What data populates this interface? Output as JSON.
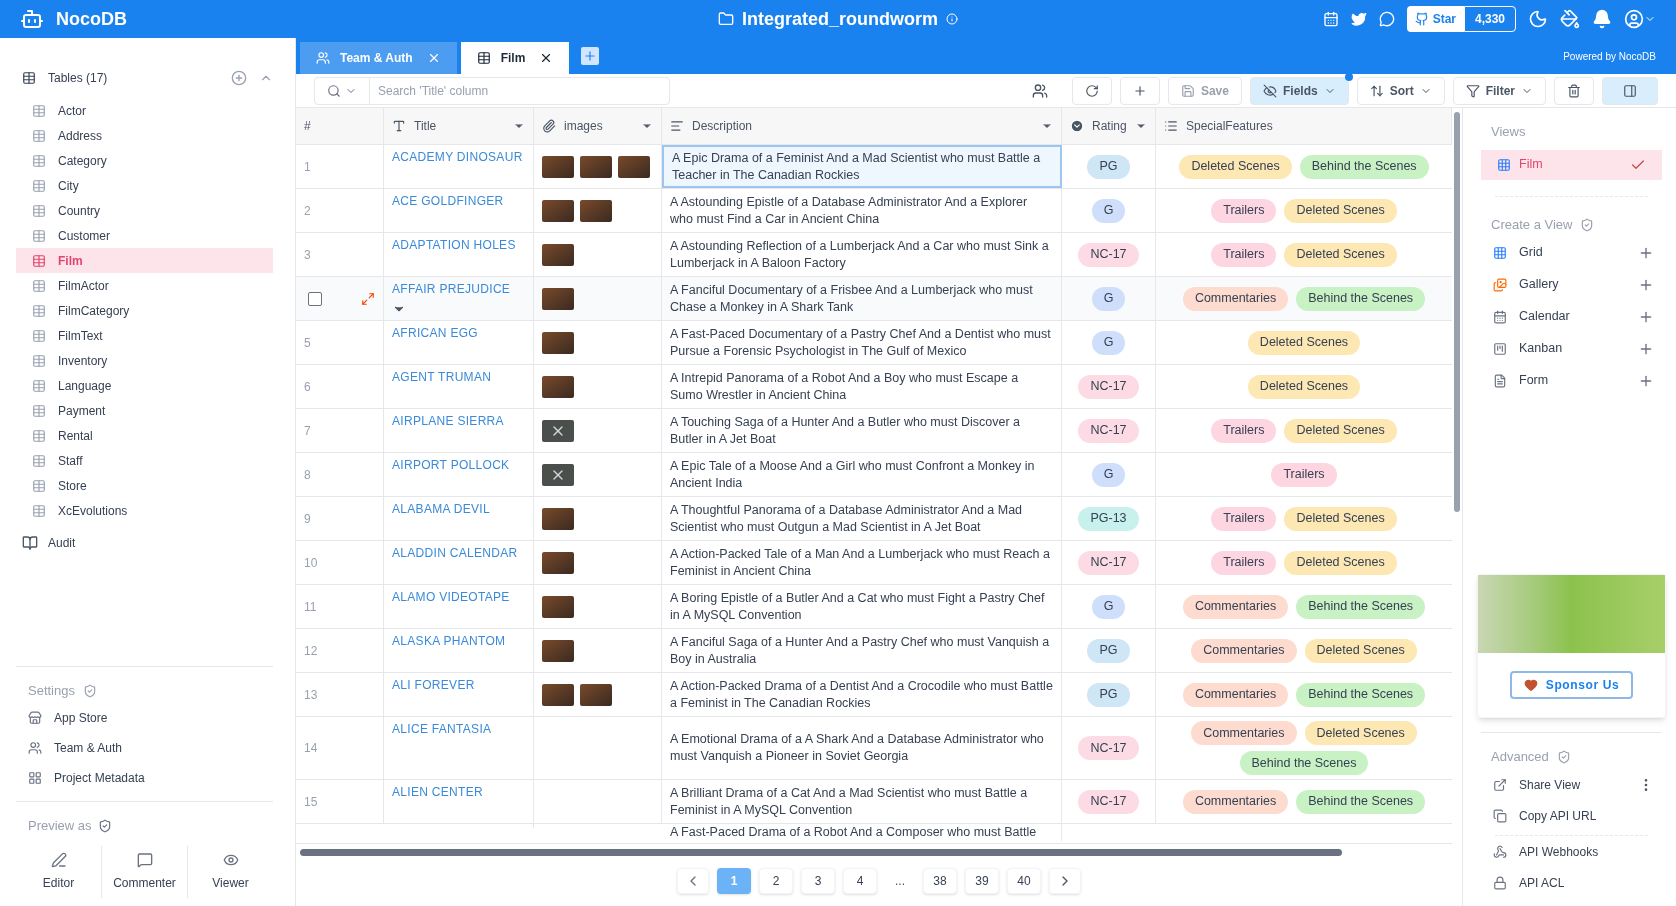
{
  "top_bar": {
    "brand": "NocoDB",
    "project": "Integrated_roundworm",
    "star_label": "Star",
    "star_count": "4,330"
  },
  "tabs": [
    {
      "label": "Team & Auth",
      "kind": "team",
      "selected": false
    },
    {
      "label": "Film",
      "kind": "table",
      "selected": true
    }
  ],
  "powered_by": "Powered by NocoDB",
  "sidebar": {
    "tables_header": "Tables (17)",
    "tables": [
      {
        "label": "Actor",
        "selected": false
      },
      {
        "label": "Address",
        "selected": false
      },
      {
        "label": "Category",
        "selected": false
      },
      {
        "label": "City",
        "selected": false
      },
      {
        "label": "Country",
        "selected": false
      },
      {
        "label": "Customer",
        "selected": false
      },
      {
        "label": "Film",
        "selected": true
      },
      {
        "label": "FilmActor",
        "selected": false
      },
      {
        "label": "FilmCategory",
        "selected": false
      },
      {
        "label": "FilmText",
        "selected": false
      },
      {
        "label": "Inventory",
        "selected": false
      },
      {
        "label": "Language",
        "selected": false
      },
      {
        "label": "Payment",
        "selected": false
      },
      {
        "label": "Rental",
        "selected": false
      },
      {
        "label": "Staff",
        "selected": false
      },
      {
        "label": "Store",
        "selected": false
      },
      {
        "label": "XcEvolutions",
        "selected": false
      }
    ],
    "audit": "Audit",
    "settings_title": "Settings",
    "settings_items": [
      {
        "label": "App Store",
        "kind": "store"
      },
      {
        "label": "Team & Auth",
        "kind": "team"
      },
      {
        "label": "Project Metadata",
        "kind": "metadata"
      }
    ],
    "preview_title": "Preview as",
    "preview_roles": [
      {
        "label": "Editor",
        "kind": "editor"
      },
      {
        "label": "Commenter",
        "kind": "commenter"
      },
      {
        "label": "Viewer",
        "kind": "viewer"
      }
    ]
  },
  "toolbar": {
    "search_placeholder": "Search 'Title' column",
    "actions": [
      {
        "kind": "reload",
        "active": false,
        "disabled": false
      },
      {
        "kind": "add",
        "active": false,
        "disabled": false
      },
      {
        "kind": "save",
        "label": "Save",
        "active": false,
        "disabled": true
      },
      {
        "kind": "fields",
        "label": "Fields",
        "active": true,
        "disabled": false
      },
      {
        "kind": "sort",
        "label": "Sort",
        "active": false,
        "disabled": false
      },
      {
        "kind": "filter",
        "label": "Filter",
        "active": false,
        "disabled": false
      },
      {
        "kind": "delete",
        "active": false,
        "disabled": false
      },
      {
        "kind": "panel",
        "active": true,
        "disabled": false
      }
    ]
  },
  "table": {
    "columns": [
      {
        "label": "#",
        "kind": "index"
      },
      {
        "label": "Title",
        "kind": "text"
      },
      {
        "label": "images",
        "kind": "attachment"
      },
      {
        "label": "Description",
        "kind": "longtext"
      },
      {
        "label": "Rating",
        "kind": "select"
      },
      {
        "label": "SpecialFeatures",
        "kind": "multiselect"
      }
    ],
    "rows": [
      {
        "number": "1",
        "hovered": false,
        "title": "ACADEMY DINOSAUR",
        "images": [
          {
            "kind": "photo"
          },
          {
            "kind": "photo"
          },
          {
            "kind": "photo"
          }
        ],
        "description": "A Epic Drama of a Feminist And a Mad Scientist who must Battle a Teacher in The Canadian Rockies",
        "description_active": true,
        "rating": {
          "label": "PG",
          "color": "#cfe6f7"
        },
        "features": [
          {
            "label": "Deleted Scenes",
            "color": "#fde7b3"
          },
          {
            "label": "Behind the Scenes",
            "color": "#c9f2c4"
          }
        ]
      },
      {
        "number": "2",
        "hovered": false,
        "title": "ACE GOLDFINGER",
        "images": [
          {
            "kind": "photo"
          },
          {
            "kind": "photo"
          }
        ],
        "description": "A Astounding Epistle of a Database Administrator And a Explorer who must Find a Car in Ancient China",
        "description_active": false,
        "rating": {
          "label": "G",
          "color": "#cfdffb"
        },
        "features": [
          {
            "label": "Trailers",
            "color": "#fdd6e1"
          },
          {
            "label": "Deleted Scenes",
            "color": "#fde7b3"
          }
        ]
      },
      {
        "number": "3",
        "hovered": false,
        "title": "ADAPTATION HOLES",
        "images": [
          {
            "kind": "photo"
          }
        ],
        "description": "A Astounding Reflection of a Lumberjack And a Car who must Sink a Lumberjack in A Baloon Factory",
        "description_active": false,
        "rating": {
          "label": "NC-17",
          "color": "#fddbe4"
        },
        "features": [
          {
            "label": "Trailers",
            "color": "#fdd6e1"
          },
          {
            "label": "Deleted Scenes",
            "color": "#fde7b3"
          }
        ]
      },
      {
        "hovered": true,
        "checked": false,
        "title": "AFFAIR PREJUDICE",
        "images": [
          {
            "kind": "photo"
          }
        ],
        "description": "A Fanciful Documentary of a Frisbee And a Lumberjack who must Chase a Monkey in A Shark Tank",
        "description_active": false,
        "rating": {
          "label": "G",
          "color": "#cfdffb"
        },
        "features": [
          {
            "label": "Commentaries",
            "color": "#fddccf"
          },
          {
            "label": "Behind the Scenes",
            "color": "#c9f2c4"
          }
        ]
      },
      {
        "number": "5",
        "hovered": false,
        "title": "AFRICAN EGG",
        "images": [
          {
            "kind": "photo"
          }
        ],
        "description": "A Fast-Paced Documentary of a Pastry Chef And a Dentist who must Pursue a Forensic Psychologist in The Gulf of Mexico",
        "description_active": false,
        "rating": {
          "label": "G",
          "color": "#cfdffb"
        },
        "features": [
          {
            "label": "Deleted Scenes",
            "color": "#fde7b3"
          }
        ]
      },
      {
        "number": "6",
        "hovered": false,
        "title": "AGENT TRUMAN",
        "images": [
          {
            "kind": "photo"
          }
        ],
        "description": "A Intrepid Panorama of a Robot And a Boy who must Escape a Sumo Wrestler in Ancient China",
        "description_active": false,
        "rating": {
          "label": "NC-17",
          "color": "#fddbe4"
        },
        "features": [
          {
            "label": "Deleted Scenes",
            "color": "#fde7b3"
          }
        ]
      },
      {
        "number": "7",
        "hovered": false,
        "title": "AIRPLANE SIERRA",
        "images": [
          {
            "kind": "broken"
          }
        ],
        "description": "A Touching Saga of a Hunter And a Butler who must Discover a Butler in A Jet Boat",
        "description_active": false,
        "rating": {
          "label": "NC-17",
          "color": "#fddbe4"
        },
        "features": [
          {
            "label": "Trailers",
            "color": "#fdd6e1"
          },
          {
            "label": "Deleted Scenes",
            "color": "#fde7b3"
          }
        ]
      },
      {
        "number": "8",
        "hovered": false,
        "title": "AIRPORT POLLOCK",
        "images": [
          {
            "kind": "broken"
          }
        ],
        "description": "A Epic Tale of a Moose And a Girl who must Confront a Monkey in Ancient India",
        "description_active": false,
        "rating": {
          "label": "G",
          "color": "#cfdffb"
        },
        "features": [
          {
            "label": "Trailers",
            "color": "#fdd6e1"
          }
        ]
      },
      {
        "number": "9",
        "hovered": false,
        "title": "ALABAMA DEVIL",
        "images": [
          {
            "kind": "photo"
          }
        ],
        "description": "A Thoughtful Panorama of a Database Administrator And a Mad Scientist who must Outgun a Mad Scientist in A Jet Boat",
        "description_active": false,
        "rating": {
          "label": "PG-13",
          "color": "#c8f0ec"
        },
        "features": [
          {
            "label": "Trailers",
            "color": "#fdd6e1"
          },
          {
            "label": "Deleted Scenes",
            "color": "#fde7b3"
          }
        ]
      },
      {
        "number": "10",
        "hovered": false,
        "title": "ALADDIN CALENDAR",
        "images": [
          {
            "kind": "photo"
          }
        ],
        "description": "A Action-Packed Tale of a Man And a Lumberjack who must Reach a Feminist in Ancient China",
        "description_active": false,
        "rating": {
          "label": "NC-17",
          "color": "#fddbe4"
        },
        "features": [
          {
            "label": "Trailers",
            "color": "#fdd6e1"
          },
          {
            "label": "Deleted Scenes",
            "color": "#fde7b3"
          }
        ]
      },
      {
        "number": "11",
        "hovered": false,
        "title": "ALAMO VIDEOTAPE",
        "images": [
          {
            "kind": "photo"
          }
        ],
        "description": "A Boring Epistle of a Butler And a Cat who must Fight a Pastry Chef in A MySQL Convention",
        "description_active": false,
        "rating": {
          "label": "G",
          "color": "#cfdffb"
        },
        "features": [
          {
            "label": "Commentaries",
            "color": "#fddccf"
          },
          {
            "label": "Behind the Scenes",
            "color": "#c9f2c4"
          }
        ]
      },
      {
        "number": "12",
        "hovered": false,
        "title": "ALASKA PHANTOM",
        "images": [
          {
            "kind": "photo"
          }
        ],
        "description": "A Fanciful Saga of a Hunter And a Pastry Chef who must Vanquish a Boy in Australia",
        "description_active": false,
        "rating": {
          "label": "PG",
          "color": "#cfe6f7"
        },
        "features": [
          {
            "label": "Commentaries",
            "color": "#fddccf"
          },
          {
            "label": "Deleted Scenes",
            "color": "#fde7b3"
          }
        ]
      },
      {
        "number": "13",
        "hovered": false,
        "title": "ALI FOREVER",
        "images": [
          {
            "kind": "photo"
          },
          {
            "kind": "photo"
          }
        ],
        "description": "A Action-Packed Drama of a Dentist And a Crocodile who must Battle a Feminist in The Canadian Rockies",
        "description_active": false,
        "rating": {
          "label": "PG",
          "color": "#cfe6f7"
        },
        "features": [
          {
            "label": "Commentaries",
            "color": "#fddccf"
          },
          {
            "label": "Behind the Scenes",
            "color": "#c9f2c4"
          }
        ]
      },
      {
        "number": "14",
        "hovered": false,
        "title": "ALICE FANTASIA",
        "images": [],
        "description": "A Emotional Drama of a A Shark And a Database Administrator who must Vanquish a Pioneer in Soviet Georgia",
        "description_active": false,
        "rating": {
          "label": "NC-17",
          "color": "#fddbe4"
        },
        "features": [
          {
            "label": "Commentaries",
            "color": "#fddccf"
          },
          {
            "label": "Deleted Scenes",
            "color": "#fde7b3"
          },
          {
            "label": "Behind the Scenes",
            "color": "#c9f2c4"
          }
        ]
      },
      {
        "number": "15",
        "hovered": false,
        "title": "ALIEN CENTER",
        "images": [],
        "description": "A Brilliant Drama of a Cat And a Mad Scientist who must Battle a Feminist in A MySQL Convention",
        "description_active": false,
        "rating": {
          "label": "NC-17",
          "color": "#fddbe4"
        },
        "features": [
          {
            "label": "Commentaries",
            "color": "#fddccf"
          },
          {
            "label": "Behind the Scenes",
            "color": "#c9f2c4"
          }
        ]
      },
      {
        "hovered": false,
        "images": [],
        "description": "A Fast-Paced Drama of a Robot And a Composer who must Battle",
        "description_active": false,
        "features": []
      }
    ]
  },
  "pagination": [
    {
      "kind": "prev"
    },
    {
      "kind": "page",
      "label": "1",
      "selected": true
    },
    {
      "kind": "page",
      "label": "2",
      "selected": false
    },
    {
      "kind": "page",
      "label": "3",
      "selected": false
    },
    {
      "kind": "page",
      "label": "4",
      "selected": false
    },
    {
      "kind": "gap",
      "label": "..."
    },
    {
      "kind": "page",
      "label": "38",
      "selected": false
    },
    {
      "kind": "page",
      "label": "39",
      "selected": false
    },
    {
      "kind": "page",
      "label": "40",
      "selected": false
    },
    {
      "kind": "next"
    }
  ],
  "views_panel": {
    "title": "Views",
    "views": [
      {
        "label": "Film",
        "selected": true
      }
    ],
    "create_title": "Create a View",
    "create_items": [
      {
        "label": "Grid",
        "kind": "grid"
      },
      {
        "label": "Gallery",
        "kind": "gallery"
      },
      {
        "label": "Calendar",
        "kind": "calendar"
      },
      {
        "label": "Kanban",
        "kind": "kanban"
      },
      {
        "label": "Form",
        "kind": "form"
      }
    ],
    "sponsor_label": "Sponsor Us",
    "advanced_title": "Advanced",
    "advanced_items": [
      {
        "label": "Share View",
        "kind": "share"
      },
      {
        "label": "Copy API URL",
        "kind": "copy"
      },
      {
        "label": "API Webhooks",
        "kind": "webhook"
      },
      {
        "label": "API ACL",
        "kind": "acl"
      }
    ]
  }
}
